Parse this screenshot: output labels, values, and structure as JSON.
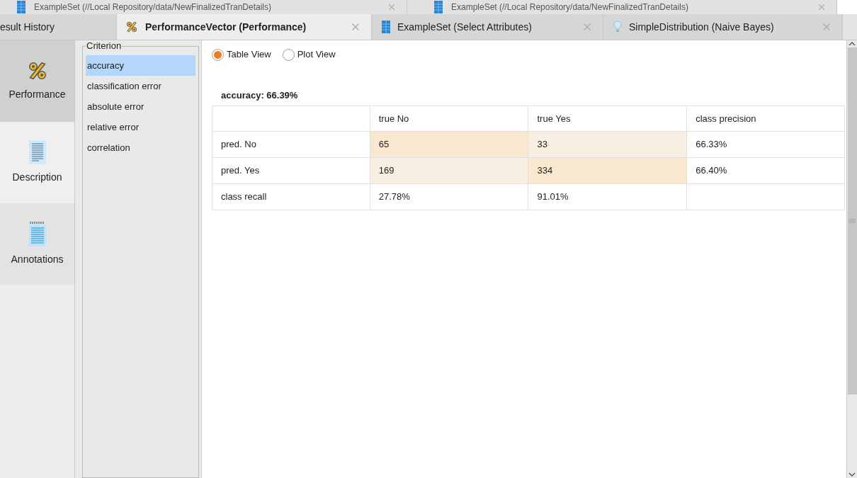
{
  "back_tabs": [
    {
      "label": "ExampleSet (//Local Repository/data/NewFinalizedTranDetails)"
    },
    {
      "label": "ExampleSet (//Local Repository/data/NewFinalizedTranDetails)"
    }
  ],
  "tabs": [
    {
      "label": "esult History",
      "selected": false
    },
    {
      "label": "PerformanceVector (Performance)",
      "selected": true
    },
    {
      "label": "ExampleSet (Select Attributes)",
      "selected": false
    },
    {
      "label": "SimpleDistribution (Naive Bayes)",
      "selected": false
    }
  ],
  "sidebar": {
    "items": [
      {
        "label": "Performance",
        "selected": true
      },
      {
        "label": "Description",
        "selected": false
      },
      {
        "label": "Annotations",
        "selected": false
      }
    ]
  },
  "criterion": {
    "title": "Criterion",
    "items": [
      {
        "label": "accuracy",
        "selected": true
      },
      {
        "label": "classification error",
        "selected": false
      },
      {
        "label": "absolute error",
        "selected": false
      },
      {
        "label": "relative error",
        "selected": false
      },
      {
        "label": "correlation",
        "selected": false
      }
    ]
  },
  "view_options": [
    {
      "label": "Table View",
      "selected": true
    },
    {
      "label": "Plot View",
      "selected": false
    }
  ],
  "result_title": "accuracy: 66.39%",
  "table": {
    "columns": [
      "true No",
      "true Yes",
      "class precision"
    ],
    "rows": [
      {
        "label": "pred. No",
        "cells": [
          {
            "text": "65",
            "kind": "correct"
          },
          {
            "text": "33",
            "kind": "error"
          },
          {
            "text": "66.33%",
            "kind": "plain"
          }
        ]
      },
      {
        "label": "pred. Yes",
        "cells": [
          {
            "text": "169",
            "kind": "error"
          },
          {
            "text": "334",
            "kind": "correct"
          },
          {
            "text": "66.40%",
            "kind": "plain"
          }
        ]
      },
      {
        "label": "class recall",
        "cells": [
          {
            "text": "27.78%",
            "kind": "plain"
          },
          {
            "text": "91.01%",
            "kind": "plain"
          },
          {
            "text": "",
            "kind": "plain"
          }
        ]
      }
    ]
  }
}
